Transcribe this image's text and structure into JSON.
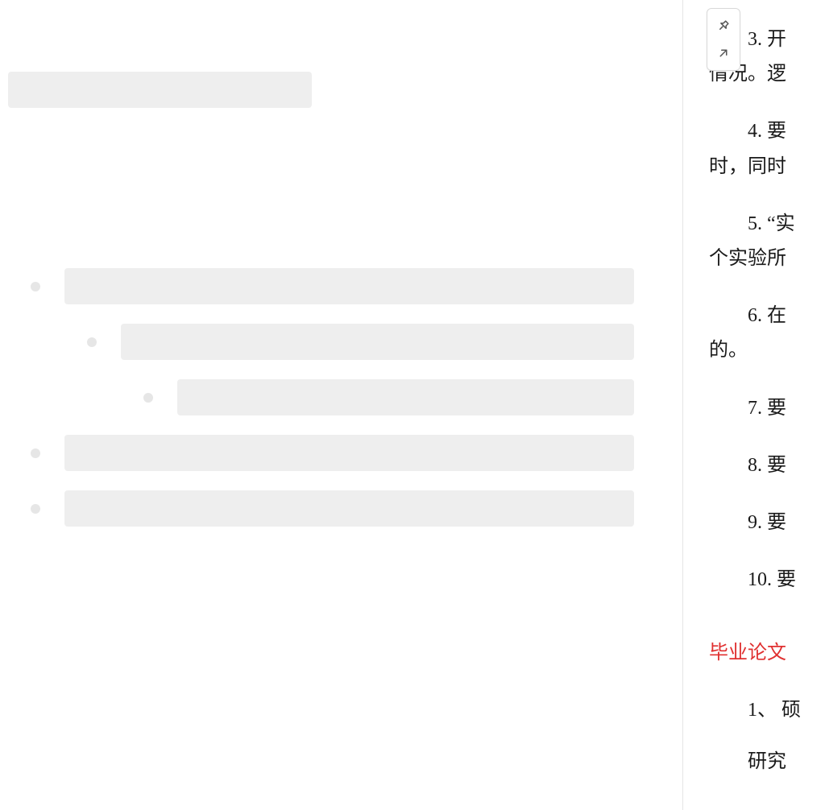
{
  "right": {
    "items": [
      {
        "line1": "3. 开",
        "line2": "情况。逻"
      },
      {
        "line1": "4. 要",
        "line2": "时，同时"
      },
      {
        "line1": "5. “实",
        "line2": "个实验所"
      },
      {
        "line1": "6. 在",
        "line2": "的。"
      },
      {
        "line1": "7. 要"
      },
      {
        "line1": "8. 要"
      },
      {
        "line1": "9. 要"
      },
      {
        "line1": "10. 要"
      }
    ],
    "heading": "毕业论文",
    "after_heading": [
      {
        "line1": "1、 硕"
      },
      {
        "line1": "研究"
      }
    ]
  },
  "toolbar": {
    "pin": "pin",
    "open": "open-external"
  }
}
